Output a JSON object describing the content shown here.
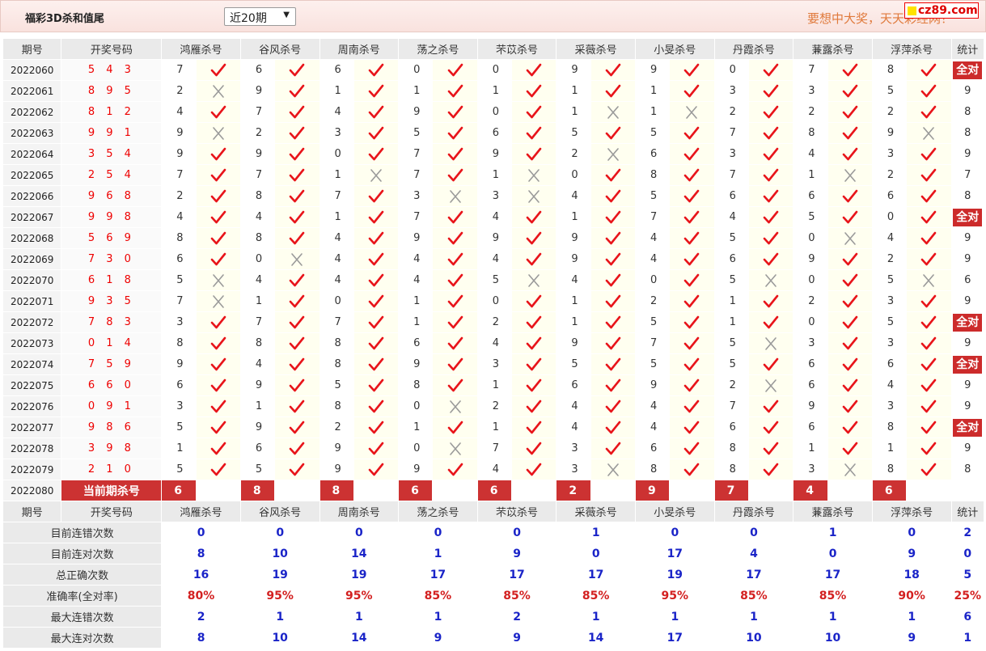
{
  "header": {
    "title": "福彩3D杀和值尾",
    "period_select": "近20期",
    "slogan": "要想中大奖，天天彩经网！",
    "logo": "cz89.com"
  },
  "columns": {
    "issue": "期号",
    "draw": "开奖号码",
    "experts": [
      "鸿雁杀号",
      "谷风杀号",
      "周南杀号",
      "荡之杀号",
      "芣苡杀号",
      "采薇杀号",
      "小旻杀号",
      "丹霞杀号",
      "蒹露杀号",
      "浮萍杀号"
    ],
    "stat": "统计"
  },
  "rows": [
    {
      "issue": "2022060",
      "draw": "5 4 3",
      "picks": [
        [
          7,
          1
        ],
        [
          6,
          1
        ],
        [
          6,
          1
        ],
        [
          0,
          1
        ],
        [
          0,
          1
        ],
        [
          9,
          1
        ],
        [
          9,
          1
        ],
        [
          0,
          1
        ],
        [
          7,
          1
        ],
        [
          8,
          1
        ]
      ],
      "stat": "全对"
    },
    {
      "issue": "2022061",
      "draw": "8 9 5",
      "picks": [
        [
          2,
          0
        ],
        [
          9,
          1
        ],
        [
          1,
          1
        ],
        [
          1,
          1
        ],
        [
          1,
          1
        ],
        [
          1,
          1
        ],
        [
          1,
          1
        ],
        [
          3,
          1
        ],
        [
          3,
          1
        ],
        [
          5,
          1
        ]
      ],
      "stat": "9"
    },
    {
      "issue": "2022062",
      "draw": "8 1 2",
      "picks": [
        [
          4,
          1
        ],
        [
          7,
          1
        ],
        [
          4,
          1
        ],
        [
          9,
          1
        ],
        [
          0,
          1
        ],
        [
          1,
          0
        ],
        [
          1,
          0
        ],
        [
          2,
          1
        ],
        [
          2,
          1
        ],
        [
          2,
          1
        ]
      ],
      "stat": "8"
    },
    {
      "issue": "2022063",
      "draw": "9 9 1",
      "picks": [
        [
          9,
          0
        ],
        [
          2,
          1
        ],
        [
          3,
          1
        ],
        [
          5,
          1
        ],
        [
          6,
          1
        ],
        [
          5,
          1
        ],
        [
          5,
          1
        ],
        [
          7,
          1
        ],
        [
          8,
          1
        ],
        [
          9,
          0
        ]
      ],
      "stat": "8"
    },
    {
      "issue": "2022064",
      "draw": "3 5 4",
      "picks": [
        [
          9,
          1
        ],
        [
          9,
          1
        ],
        [
          0,
          1
        ],
        [
          7,
          1
        ],
        [
          9,
          1
        ],
        [
          2,
          0
        ],
        [
          6,
          1
        ],
        [
          3,
          1
        ],
        [
          4,
          1
        ],
        [
          3,
          1
        ]
      ],
      "stat": "9"
    },
    {
      "issue": "2022065",
      "draw": "2 5 4",
      "picks": [
        [
          7,
          1
        ],
        [
          7,
          1
        ],
        [
          1,
          0
        ],
        [
          7,
          1
        ],
        [
          1,
          0
        ],
        [
          0,
          1
        ],
        [
          8,
          1
        ],
        [
          7,
          1
        ],
        [
          1,
          0
        ],
        [
          2,
          1
        ]
      ],
      "stat": "7"
    },
    {
      "issue": "2022066",
      "draw": "9 6 8",
      "picks": [
        [
          2,
          1
        ],
        [
          8,
          1
        ],
        [
          7,
          1
        ],
        [
          3,
          0
        ],
        [
          3,
          0
        ],
        [
          4,
          1
        ],
        [
          5,
          1
        ],
        [
          6,
          1
        ],
        [
          6,
          1
        ],
        [
          6,
          1
        ]
      ],
      "stat": "8"
    },
    {
      "issue": "2022067",
      "draw": "9 9 8",
      "picks": [
        [
          4,
          1
        ],
        [
          4,
          1
        ],
        [
          1,
          1
        ],
        [
          7,
          1
        ],
        [
          4,
          1
        ],
        [
          1,
          1
        ],
        [
          7,
          1
        ],
        [
          4,
          1
        ],
        [
          5,
          1
        ],
        [
          0,
          1
        ]
      ],
      "stat": "全对"
    },
    {
      "issue": "2022068",
      "draw": "5 6 9",
      "picks": [
        [
          8,
          1
        ],
        [
          8,
          1
        ],
        [
          4,
          1
        ],
        [
          9,
          1
        ],
        [
          9,
          1
        ],
        [
          9,
          1
        ],
        [
          4,
          1
        ],
        [
          5,
          1
        ],
        [
          0,
          0
        ],
        [
          4,
          1
        ]
      ],
      "stat": "9"
    },
    {
      "issue": "2022069",
      "draw": "7 3 0",
      "picks": [
        [
          6,
          1
        ],
        [
          0,
          0
        ],
        [
          4,
          1
        ],
        [
          4,
          1
        ],
        [
          4,
          1
        ],
        [
          9,
          1
        ],
        [
          4,
          1
        ],
        [
          6,
          1
        ],
        [
          9,
          1
        ],
        [
          2,
          1
        ]
      ],
      "stat": "9"
    },
    {
      "issue": "2022070",
      "draw": "6 1 8",
      "picks": [
        [
          5,
          0
        ],
        [
          4,
          1
        ],
        [
          4,
          1
        ],
        [
          4,
          1
        ],
        [
          5,
          0
        ],
        [
          4,
          1
        ],
        [
          0,
          1
        ],
        [
          5,
          0
        ],
        [
          0,
          1
        ],
        [
          5,
          0
        ]
      ],
      "stat": "6"
    },
    {
      "issue": "2022071",
      "draw": "9 3 5",
      "picks": [
        [
          7,
          0
        ],
        [
          1,
          1
        ],
        [
          0,
          1
        ],
        [
          1,
          1
        ],
        [
          0,
          1
        ],
        [
          1,
          1
        ],
        [
          2,
          1
        ],
        [
          1,
          1
        ],
        [
          2,
          1
        ],
        [
          3,
          1
        ]
      ],
      "stat": "9"
    },
    {
      "issue": "2022072",
      "draw": "7 8 3",
      "picks": [
        [
          3,
          1
        ],
        [
          7,
          1
        ],
        [
          7,
          1
        ],
        [
          1,
          1
        ],
        [
          2,
          1
        ],
        [
          1,
          1
        ],
        [
          5,
          1
        ],
        [
          1,
          1
        ],
        [
          0,
          1
        ],
        [
          5,
          1
        ]
      ],
      "stat": "全对"
    },
    {
      "issue": "2022073",
      "draw": "0 1 4",
      "picks": [
        [
          8,
          1
        ],
        [
          8,
          1
        ],
        [
          8,
          1
        ],
        [
          6,
          1
        ],
        [
          4,
          1
        ],
        [
          9,
          1
        ],
        [
          7,
          1
        ],
        [
          5,
          0
        ],
        [
          3,
          1
        ],
        [
          3,
          1
        ]
      ],
      "stat": "9"
    },
    {
      "issue": "2022074",
      "draw": "7 5 9",
      "picks": [
        [
          9,
          1
        ],
        [
          4,
          1
        ],
        [
          8,
          1
        ],
        [
          9,
          1
        ],
        [
          3,
          1
        ],
        [
          5,
          1
        ],
        [
          5,
          1
        ],
        [
          5,
          1
        ],
        [
          6,
          1
        ],
        [
          6,
          1
        ]
      ],
      "stat": "全对"
    },
    {
      "issue": "2022075",
      "draw": "6 6 0",
      "picks": [
        [
          6,
          1
        ],
        [
          9,
          1
        ],
        [
          5,
          1
        ],
        [
          8,
          1
        ],
        [
          1,
          1
        ],
        [
          6,
          1
        ],
        [
          9,
          1
        ],
        [
          2,
          0
        ],
        [
          6,
          1
        ],
        [
          4,
          1
        ]
      ],
      "stat": "9"
    },
    {
      "issue": "2022076",
      "draw": "0 9 1",
      "picks": [
        [
          3,
          1
        ],
        [
          1,
          1
        ],
        [
          8,
          1
        ],
        [
          0,
          0
        ],
        [
          2,
          1
        ],
        [
          4,
          1
        ],
        [
          4,
          1
        ],
        [
          7,
          1
        ],
        [
          9,
          1
        ],
        [
          3,
          1
        ]
      ],
      "stat": "9"
    },
    {
      "issue": "2022077",
      "draw": "9 8 6",
      "picks": [
        [
          5,
          1
        ],
        [
          9,
          1
        ],
        [
          2,
          1
        ],
        [
          1,
          1
        ],
        [
          1,
          1
        ],
        [
          4,
          1
        ],
        [
          4,
          1
        ],
        [
          6,
          1
        ],
        [
          6,
          1
        ],
        [
          8,
          1
        ]
      ],
      "stat": "全对"
    },
    {
      "issue": "2022078",
      "draw": "3 9 8",
      "picks": [
        [
          1,
          1
        ],
        [
          6,
          1
        ],
        [
          9,
          1
        ],
        [
          0,
          0
        ],
        [
          7,
          1
        ],
        [
          3,
          1
        ],
        [
          6,
          1
        ],
        [
          8,
          1
        ],
        [
          1,
          1
        ],
        [
          1,
          1
        ]
      ],
      "stat": "9"
    },
    {
      "issue": "2022079",
      "draw": "2 1 0",
      "picks": [
        [
          5,
          1
        ],
        [
          5,
          1
        ],
        [
          9,
          1
        ],
        [
          9,
          1
        ],
        [
          4,
          1
        ],
        [
          3,
          0
        ],
        [
          8,
          1
        ],
        [
          8,
          1
        ],
        [
          3,
          0
        ],
        [
          8,
          1
        ]
      ],
      "stat": "8"
    }
  ],
  "current": {
    "issue": "2022080",
    "label": "当前期杀号",
    "picks": [
      "6",
      "8",
      "8",
      "6",
      "6",
      "2",
      "9",
      "7",
      "4",
      "6"
    ]
  },
  "summary": [
    {
      "label": "目前连错次数",
      "values": [
        "0",
        "0",
        "0",
        "0",
        "0",
        "1",
        "0",
        "0",
        "1",
        "0"
      ],
      "stat": "2"
    },
    {
      "label": "目前连对次数",
      "values": [
        "8",
        "10",
        "14",
        "1",
        "9",
        "0",
        "17",
        "4",
        "0",
        "9"
      ],
      "stat": "0"
    },
    {
      "label": "总正确次数",
      "values": [
        "16",
        "19",
        "19",
        "17",
        "17",
        "17",
        "19",
        "17",
        "17",
        "18"
      ],
      "stat": "5"
    },
    {
      "label": "准确率(全对率)",
      "values": [
        "80%",
        "95%",
        "95%",
        "85%",
        "85%",
        "85%",
        "95%",
        "85%",
        "85%",
        "90%"
      ],
      "stat": "25%"
    },
    {
      "label": "最大连错次数",
      "values": [
        "2",
        "1",
        "1",
        "1",
        "2",
        "1",
        "1",
        "1",
        "1",
        "1"
      ],
      "stat": "6"
    },
    {
      "label": "最大连对次数",
      "values": [
        "8",
        "10",
        "14",
        "9",
        "9",
        "14",
        "17",
        "10",
        "10",
        "9"
      ],
      "stat": "1"
    }
  ],
  "colors": {
    "hit": "#e8141a",
    "miss": "#9a9a9a",
    "accent": "#cc2b2b",
    "stat_blue": "#1a24c8"
  },
  "icons": {
    "hit": "check-icon",
    "miss": "cross-icon"
  }
}
